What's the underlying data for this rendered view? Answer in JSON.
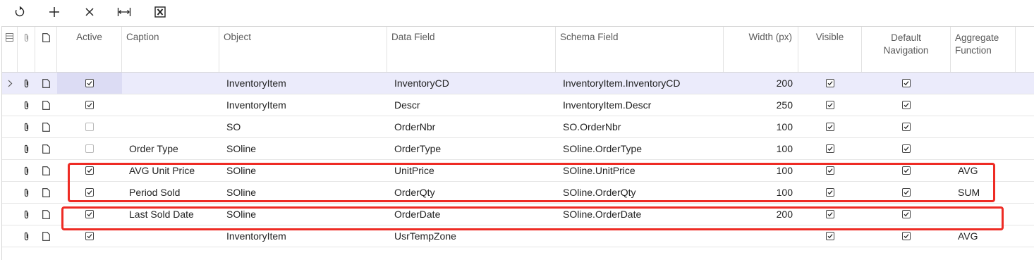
{
  "toolbar": {
    "icons": [
      "refresh-icon",
      "add-icon",
      "delete-icon",
      "fit-columns-icon",
      "export-excel-icon"
    ]
  },
  "grid": {
    "header": {
      "active": "Active",
      "caption": "Caption",
      "object": "Object",
      "data_field": "Data Field",
      "schema_field": "Schema Field",
      "width": "Width (px)",
      "visible": "Visible",
      "default_navigation": "Default Navigation",
      "aggregate_function": "Aggregate Function"
    },
    "rows": [
      {
        "active": true,
        "caption": "",
        "object": "InventoryItem",
        "data_field": "InventoryCD",
        "schema_field": "InventoryItem.InventoryCD",
        "width": "200",
        "visible": true,
        "default_navigation": true,
        "aggregate": "",
        "selected": true
      },
      {
        "active": true,
        "caption": "",
        "object": "InventoryItem",
        "data_field": "Descr",
        "schema_field": "InventoryItem.Descr",
        "width": "250",
        "visible": true,
        "default_navigation": true,
        "aggregate": ""
      },
      {
        "active": false,
        "caption": "",
        "object": "SO",
        "data_field": "OrderNbr",
        "schema_field": "SO.OrderNbr",
        "width": "100",
        "visible": true,
        "default_navigation": true,
        "aggregate": ""
      },
      {
        "active": false,
        "caption": "Order Type",
        "object": "SOline",
        "data_field": "OrderType",
        "schema_field": "SOline.OrderType",
        "width": "100",
        "visible": true,
        "default_navigation": true,
        "aggregate": ""
      },
      {
        "active": true,
        "caption": "AVG Unit Price",
        "object": "SOline",
        "data_field": "UnitPrice",
        "schema_field": "SOline.UnitPrice",
        "width": "100",
        "visible": true,
        "default_navigation": true,
        "aggregate": "AVG"
      },
      {
        "active": true,
        "caption": "Period Sold",
        "object": "SOline",
        "data_field": "OrderQty",
        "schema_field": "SOline.OrderQty",
        "width": "100",
        "visible": true,
        "default_navigation": true,
        "aggregate": "SUM"
      },
      {
        "active": true,
        "caption": "Last Sold Date",
        "object": "SOline",
        "data_field": "OrderDate",
        "schema_field": "SOline.OrderDate",
        "width": "200",
        "visible": true,
        "default_navigation": true,
        "aggregate": ""
      },
      {
        "active": true,
        "caption": "",
        "object": "InventoryItem",
        "data_field": "UsrTempZone",
        "schema_field": "",
        "width": "",
        "visible": true,
        "default_navigation": true,
        "aggregate": "AVG"
      }
    ]
  },
  "colors": {
    "highlight": "#ee2b24",
    "selected_row": "#ebebfb",
    "selected_cell": "#dcdcf4"
  }
}
